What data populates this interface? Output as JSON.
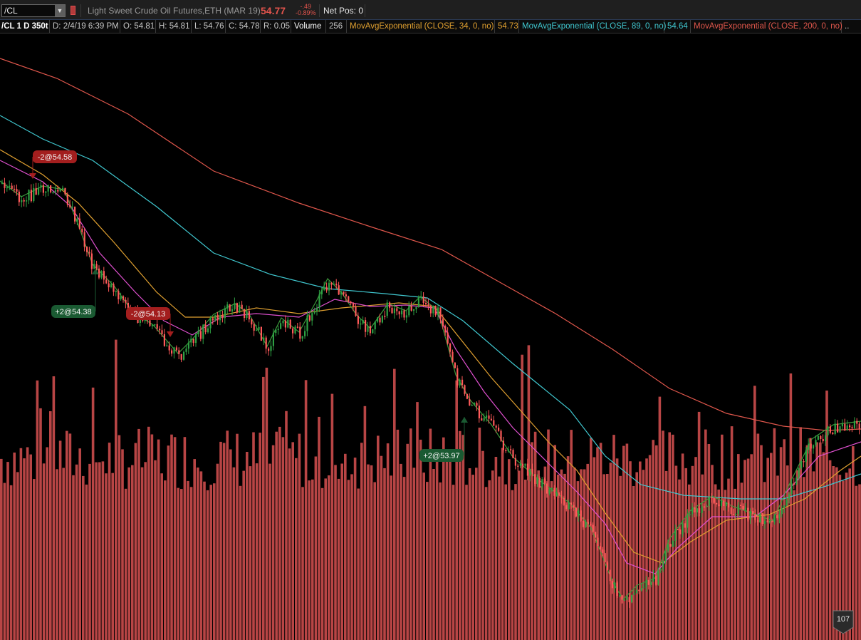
{
  "header": {
    "symbol": "/CL",
    "description": "Light Sweet Crude Oil Futures,ETH (MAR 19)",
    "last_price": "54.77",
    "net_change": "-.49",
    "pct_change": "-0.89%",
    "net_position": "Net Pos: 0"
  },
  "infobar": {
    "chart_label": "/CL 1 D 350t",
    "datetime": "D: 2/4/19 6:39 PM",
    "open": "O: 54.81",
    "high": "H: 54.81",
    "low": "L: 54.76",
    "close": "C: 54.78",
    "range": "R: 0.05",
    "volume_label": "Volume",
    "volume_value": "256",
    "ema34_label": "MovAvgExponential (CLOSE, 34, 0, no)",
    "ema34_value": "54.73",
    "ema89_label": "MovAvgExponential (CLOSE, 89, 0, no)",
    "ema89_value": "54.64",
    "ema200_label": "MovAvgExponential (CLOSE, 200, 0, no)",
    "more": ".."
  },
  "colors": {
    "up_candle": "#2ea043",
    "down_candle": "#ff5a5a",
    "volume_bar": "#b84545",
    "ema34": "#e0a030",
    "ema89": "#40c8d0",
    "ema200": "#e0574c",
    "ema_short": "#e050d0",
    "ema_fast": "#3c9a3c",
    "sell_badge": "#a31e1e",
    "buy_badge": "#1a5a32"
  },
  "trades": [
    {
      "side": "sell",
      "label": "-2@54.58"
    },
    {
      "side": "buy",
      "label": "+2@54.38"
    },
    {
      "side": "sell",
      "label": "-2@54.13"
    },
    {
      "side": "buy",
      "label": "+2@53.97"
    }
  ],
  "bubble": {
    "value": "107"
  }
}
